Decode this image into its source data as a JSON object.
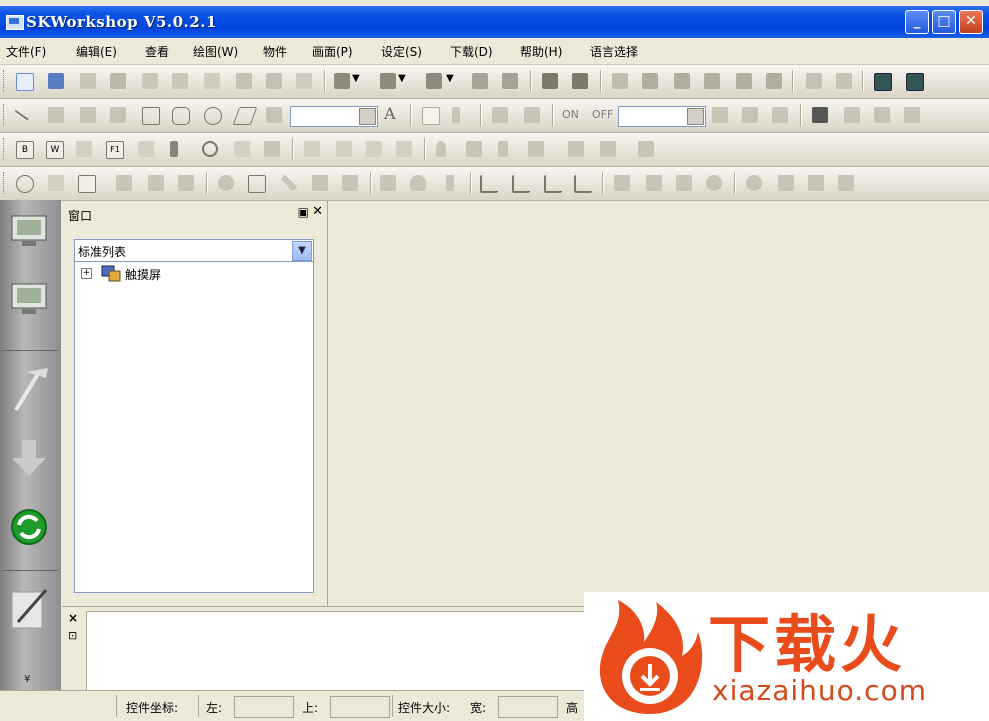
{
  "window": {
    "title": "SKWorkshop V5.0.2.1",
    "minimize": "_",
    "maximize": "□",
    "close": "✕"
  },
  "menu": [
    "文件(F)",
    "编辑(E)",
    "查看",
    "绘图(W)",
    "物件",
    "画面(P)",
    "设定(S)",
    "下载(D)",
    "帮助(H)",
    "语言选择"
  ],
  "toolbar2": {
    "on_label": "ON",
    "off_label": "OFF"
  },
  "panel": {
    "title": "窗口",
    "pin_icon": "pin-icon",
    "select_value": "标准列表",
    "tree": [
      {
        "label": "触摸屏",
        "expand": "+"
      }
    ]
  },
  "output": {
    "close": "×",
    "pin": "⊡"
  },
  "status": {
    "coord_label": "控件坐标:",
    "left_label": "左:",
    "top_label": "上:",
    "size_label": "控件大小:",
    "width_label": "宽:",
    "height_label": "高"
  },
  "watermark": {
    "brand": "下载火",
    "url": "xiazaihuo.com"
  },
  "colors": {
    "titlebar": "#0a54e6",
    "watermark": "#e94b1b"
  }
}
